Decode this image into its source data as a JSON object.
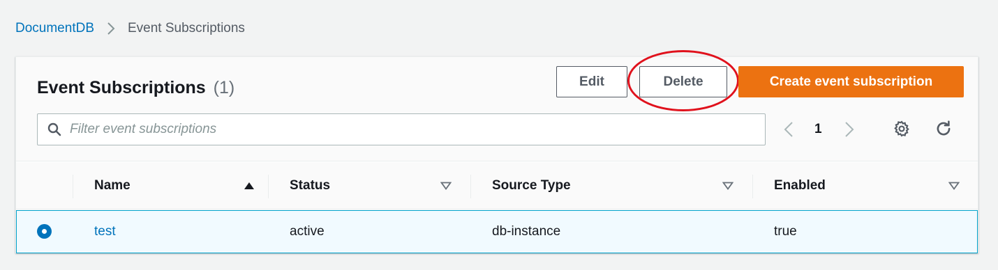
{
  "breadcrumb": {
    "root": "DocumentDB",
    "current": "Event Subscriptions"
  },
  "panel": {
    "title": "Event Subscriptions",
    "count": "(1)"
  },
  "actions": {
    "edit_label": "Edit",
    "delete_label": "Delete",
    "create_label": "Create event subscription"
  },
  "search": {
    "value": "",
    "placeholder": "Filter event subscriptions"
  },
  "pagination": {
    "current_page": "1"
  },
  "table": {
    "columns": [
      {
        "label": "Name",
        "sort": "ascending"
      },
      {
        "label": "Status",
        "sort": "none"
      },
      {
        "label": "Source Type",
        "sort": "none"
      },
      {
        "label": "Enabled",
        "sort": "none"
      }
    ],
    "rows": [
      {
        "name": "test",
        "status": "active",
        "source_type": "db-instance",
        "enabled": "true",
        "selected": true
      }
    ]
  },
  "colors": {
    "primary": "#ec7211",
    "link": "#0073bb",
    "annotation": "#e0111c",
    "selected_row_border": "#00a1c9"
  },
  "icons": [
    "chevron-right-icon",
    "search-icon",
    "chevron-left-icon",
    "settings-gear-icon",
    "refresh-icon",
    "sort-ascending-icon",
    "sort-icon"
  ]
}
